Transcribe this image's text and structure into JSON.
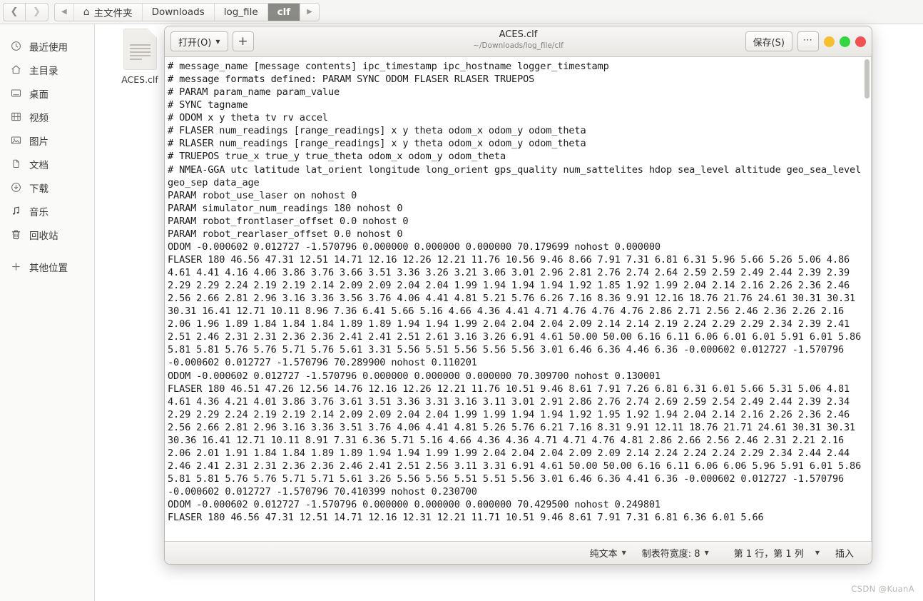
{
  "filemanager": {
    "nav": {
      "back_icon": "chevron-left-icon",
      "forward_icon": "chevron-right-icon",
      "prev_crumb_icon": "triangle-left-icon",
      "next_crumb_icon": "triangle-right-icon"
    },
    "breadcrumbs": [
      {
        "label": "主文件夹",
        "icon": "home-icon",
        "active": false
      },
      {
        "label": "Downloads",
        "active": false
      },
      {
        "label": "log_file",
        "active": false
      },
      {
        "label": "clf",
        "active": true
      }
    ],
    "sidebar": [
      {
        "label": "最近使用",
        "icon": "clock-icon"
      },
      {
        "label": "主目录",
        "icon": "home-icon"
      },
      {
        "label": "桌面",
        "icon": "desktop-icon"
      },
      {
        "label": "视频",
        "icon": "film-icon"
      },
      {
        "label": "图片",
        "icon": "image-icon"
      },
      {
        "label": "文档",
        "icon": "documents-icon"
      },
      {
        "label": "下载",
        "icon": "download-icon"
      },
      {
        "label": "音乐",
        "icon": "music-note-icon"
      },
      {
        "label": "回收站",
        "icon": "trash-icon"
      },
      {
        "label": "其他位置",
        "icon": "plus-icon"
      }
    ],
    "file": {
      "name": "ACES.clf",
      "icon": "text-document-icon"
    }
  },
  "editor": {
    "header": {
      "open_button": "打开(O)",
      "open_caret_icon": "caret-down-icon",
      "new_button_icon": "plus-icon",
      "title": "ACES.clf",
      "subtitle": "~/Downloads/log_file/clf",
      "save_button": "保存(S)",
      "menu_button_icon": "ellipsis-icon",
      "window_buttons": [
        {
          "name": "minimize",
          "color": "#f5c02f"
        },
        {
          "name": "maximize",
          "color": "#34d742"
        },
        {
          "name": "close",
          "color": "#f05252"
        }
      ]
    },
    "statusbar": {
      "language": "纯文本",
      "language_caret_icon": "caret-down-icon",
      "tab_width": "制表符宽度: 8",
      "tab_width_caret_icon": "caret-down-icon",
      "position": "第 1 行，第 1 列",
      "position_caret_icon": "caret-down-icon",
      "insert_mode": "插入"
    },
    "content": "# message_name [message contents] ipc_timestamp ipc_hostname logger_timestamp\n# message formats defined: PARAM SYNC ODOM FLASER RLASER TRUEPOS\n# PARAM param_name param_value\n# SYNC tagname\n# ODOM x y theta tv rv accel\n# FLASER num_readings [range_readings] x y theta odom_x odom_y odom_theta\n# RLASER num_readings [range_readings] x y theta odom_x odom_y odom_theta\n# TRUEPOS true_x true_y true_theta odom_x odom_y odom_theta\n# NMEA-GGA utc latitude lat_orient longitude long_orient gps_quality num_sattelites hdop sea_level altitude geo_sea_level geo_sep data_age\nPARAM robot_use_laser on nohost 0\nPARAM simulator_num_readings 180 nohost 0\nPARAM robot_frontlaser_offset 0.0 nohost 0\nPARAM robot_rearlaser_offset 0.0 nohost 0\nODOM -0.000602 0.012727 -1.570796 0.000000 0.000000 0.000000 70.179699 nohost 0.000000\nFLASER 180 46.56 47.31 12.51 14.71 12.16 12.26 12.21 11.76 10.56 9.46 8.66 7.91 7.31 6.81 6.31 5.96 5.66 5.26 5.06 4.86 4.61 4.41 4.16 4.06 3.86 3.76 3.66 3.51 3.36 3.26 3.21 3.06 3.01 2.96 2.81 2.76 2.74 2.64 2.59 2.59 2.49 2.44 2.39 2.39 2.29 2.29 2.24 2.19 2.19 2.14 2.09 2.09 2.04 2.04 1.99 1.94 1.94 1.94 1.92 1.85 1.92 1.99 2.04 2.14 2.16 2.26 2.36 2.46 2.56 2.66 2.81 2.96 3.16 3.36 3.56 3.76 4.06 4.41 4.81 5.21 5.76 6.26 7.16 8.36 9.91 12.16 18.76 21.76 24.61 30.31 30.31 30.31 16.41 12.71 10.11 8.96 7.36 6.41 5.66 5.16 4.66 4.36 4.41 4.71 4.76 4.76 4.76 2.86 2.71 2.56 2.46 2.36 2.26 2.16 2.06 1.96 1.89 1.84 1.84 1.84 1.89 1.89 1.94 1.94 1.99 2.04 2.04 2.04 2.09 2.14 2.14 2.19 2.24 2.29 2.29 2.34 2.39 2.41 2.51 2.46 2.31 2.31 2.36 2.36 2.41 2.41 2.51 2.61 3.16 3.26 6.91 4.61 50.00 50.00 6.16 6.11 6.06 6.01 6.01 5.91 6.01 5.86 5.81 5.81 5.76 5.76 5.71 5.76 5.61 3.31 5.56 5.51 5.56 5.56 5.56 3.01 6.46 6.36 4.46 6.36 -0.000602 0.012727 -1.570796 -0.000602 0.012727 -1.570796 70.289900 nohost 0.110201\nODOM -0.000602 0.012727 -1.570796 0.000000 0.000000 0.000000 70.309700 nohost 0.130001\nFLASER 180 46.51 47.26 12.56 14.76 12.16 12.26 12.21 11.76 10.51 9.46 8.61 7.91 7.26 6.81 6.31 6.01 5.66 5.31 5.06 4.81 4.61 4.36 4.21 4.01 3.86 3.76 3.61 3.51 3.36 3.31 3.16 3.11 3.01 2.91 2.86 2.76 2.74 2.69 2.59 2.54 2.49 2.44 2.39 2.34 2.29 2.29 2.24 2.19 2.19 2.14 2.09 2.09 2.04 2.04 1.99 1.99 1.94 1.94 1.92 1.95 1.92 1.94 2.04 2.14 2.16 2.26 2.36 2.46 2.56 2.66 2.81 2.96 3.16 3.36 3.51 3.76 4.06 4.41 4.81 5.26 5.76 6.21 7.16 8.31 9.91 12.11 18.76 21.71 24.61 30.31 30.31 30.36 16.41 12.71 10.11 8.91 7.31 6.36 5.71 5.16 4.66 4.36 4.36 4.71 4.71 4.76 4.81 2.86 2.66 2.56 2.46 2.31 2.21 2.16 2.06 2.01 1.91 1.84 1.84 1.89 1.89 1.94 1.94 1.99 1.99 2.04 2.04 2.04 2.09 2.09 2.14 2.24 2.24 2.24 2.29 2.34 2.44 2.44 2.46 2.41 2.31 2.31 2.36 2.36 2.46 2.41 2.51 2.56 3.11 3.31 6.91 4.61 50.00 50.00 6.16 6.11 6.06 6.06 5.96 5.91 6.01 5.86 5.81 5.81 5.76 5.76 5.71 5.71 5.61 3.26 5.56 5.56 5.51 5.51 5.56 3.01 6.46 6.36 4.41 6.36 -0.000602 0.012727 -1.570796 -0.000602 0.012727 -1.570796 70.410399 nohost 0.230700\nODOM -0.000602 0.012727 -1.570796 0.000000 0.000000 0.000000 70.429500 nohost 0.249801\nFLASER 180 46.56 47.31 12.51 14.71 12.16 12.31 12.21 11.71 10.51 9.46 8.61 7.91 7.31 6.81 6.36 6.01 5.66"
  },
  "watermark": "CSDN @KuanA"
}
